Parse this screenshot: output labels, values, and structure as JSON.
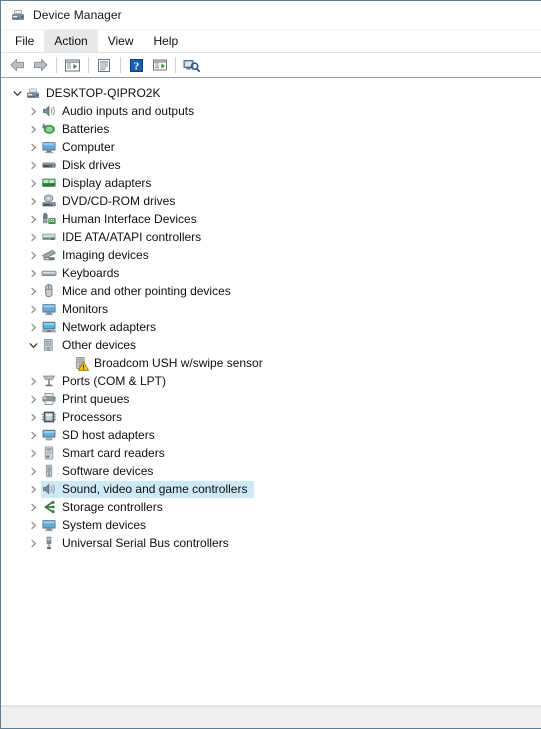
{
  "window": {
    "title": "Device Manager",
    "title_icon": "device-manager-icon"
  },
  "menubar": {
    "items": [
      {
        "label": "File",
        "icon": "",
        "active": false
      },
      {
        "label": "Action",
        "icon": "",
        "active": true
      },
      {
        "label": "View",
        "icon": "",
        "active": false
      },
      {
        "label": "Help",
        "icon": "",
        "active": false
      }
    ]
  },
  "toolbar": {
    "buttons": [
      {
        "name": "back-button",
        "icon": "arrow-left-icon",
        "tip": "Back"
      },
      {
        "name": "forward-button",
        "icon": "arrow-right-icon",
        "tip": "Forward"
      },
      {
        "name": "show-hide-console-tree-button",
        "icon": "console-tree-icon",
        "tip": "Show/Hide Console Tree"
      },
      {
        "name": "properties-button",
        "icon": "properties-icon",
        "tip": "Properties"
      },
      {
        "name": "help-button",
        "icon": "help-question-icon",
        "tip": "Help"
      },
      {
        "name": "update-driver-button",
        "icon": "update-driver-icon",
        "tip": "Update Driver Software"
      },
      {
        "name": "scan-hardware-changes-button",
        "icon": "scan-hardware-icon",
        "tip": "Scan for hardware changes"
      }
    ]
  },
  "tree": {
    "root": {
      "label": "DESKTOP-QIPRO2K",
      "icon": "computer-root-icon",
      "expanded": true,
      "depth": 0
    },
    "nodes": [
      {
        "label": "Audio inputs and outputs",
        "icon": "speaker-icon",
        "expanded": false,
        "depth": 1,
        "selected": false,
        "warning": false
      },
      {
        "label": "Batteries",
        "icon": "battery-icon",
        "expanded": false,
        "depth": 1,
        "selected": false,
        "warning": false
      },
      {
        "label": "Computer",
        "icon": "monitor-icon",
        "expanded": false,
        "depth": 1,
        "selected": false,
        "warning": false
      },
      {
        "label": "Disk drives",
        "icon": "disk-drive-icon",
        "expanded": false,
        "depth": 1,
        "selected": false,
        "warning": false
      },
      {
        "label": "Display adapters",
        "icon": "display-adapter-icon",
        "expanded": false,
        "depth": 1,
        "selected": false,
        "warning": false
      },
      {
        "label": "DVD/CD-ROM drives",
        "icon": "dvd-drive-icon",
        "expanded": false,
        "depth": 1,
        "selected": false,
        "warning": false
      },
      {
        "label": "Human Interface Devices",
        "icon": "hid-icon",
        "expanded": false,
        "depth": 1,
        "selected": false,
        "warning": false
      },
      {
        "label": "IDE ATA/ATAPI controllers",
        "icon": "ide-controller-icon",
        "expanded": false,
        "depth": 1,
        "selected": false,
        "warning": false
      },
      {
        "label": "Imaging devices",
        "icon": "imaging-device-icon",
        "expanded": false,
        "depth": 1,
        "selected": false,
        "warning": false
      },
      {
        "label": "Keyboards",
        "icon": "keyboard-icon",
        "expanded": false,
        "depth": 1,
        "selected": false,
        "warning": false
      },
      {
        "label": "Mice and other pointing devices",
        "icon": "mouse-icon",
        "expanded": false,
        "depth": 1,
        "selected": false,
        "warning": false
      },
      {
        "label": "Monitors",
        "icon": "monitor-icon",
        "expanded": false,
        "depth": 1,
        "selected": false,
        "warning": false
      },
      {
        "label": "Network adapters",
        "icon": "network-adapter-icon",
        "expanded": false,
        "depth": 1,
        "selected": false,
        "warning": false
      },
      {
        "label": "Other devices",
        "icon": "other-device-icon",
        "expanded": true,
        "depth": 1,
        "selected": false,
        "warning": false
      },
      {
        "label": "Broadcom USH w/swipe sensor",
        "icon": "other-device-icon",
        "expanded": null,
        "depth": 2,
        "selected": false,
        "warning": true
      },
      {
        "label": "Ports (COM & LPT)",
        "icon": "port-icon",
        "expanded": false,
        "depth": 1,
        "selected": false,
        "warning": false
      },
      {
        "label": "Print queues",
        "icon": "printer-icon",
        "expanded": false,
        "depth": 1,
        "selected": false,
        "warning": false
      },
      {
        "label": "Processors",
        "icon": "processor-icon",
        "expanded": false,
        "depth": 1,
        "selected": false,
        "warning": false
      },
      {
        "label": "SD host adapters",
        "icon": "sd-host-icon",
        "expanded": false,
        "depth": 1,
        "selected": false,
        "warning": false
      },
      {
        "label": "Smart card readers",
        "icon": "smartcard-icon",
        "expanded": false,
        "depth": 1,
        "selected": false,
        "warning": false
      },
      {
        "label": "Software devices",
        "icon": "software-device-icon",
        "expanded": false,
        "depth": 1,
        "selected": false,
        "warning": false
      },
      {
        "label": "Sound, video and game controllers",
        "icon": "speaker-icon",
        "expanded": false,
        "depth": 1,
        "selected": true,
        "warning": false
      },
      {
        "label": "Storage controllers",
        "icon": "storage-ctrl-icon",
        "expanded": false,
        "depth": 1,
        "selected": false,
        "warning": false
      },
      {
        "label": "System devices",
        "icon": "monitor-icon",
        "expanded": false,
        "depth": 1,
        "selected": false,
        "warning": false
      },
      {
        "label": "Universal Serial Bus controllers",
        "icon": "usb-icon",
        "expanded": false,
        "depth": 1,
        "selected": false,
        "warning": false
      }
    ]
  },
  "statusbar": {
    "text": ""
  },
  "colors": {
    "selection": "#cde8f6",
    "menu_active": "#e8e8e8",
    "window_border": "#5b7e96",
    "warning": "#ffcc00",
    "text": "#101010"
  }
}
